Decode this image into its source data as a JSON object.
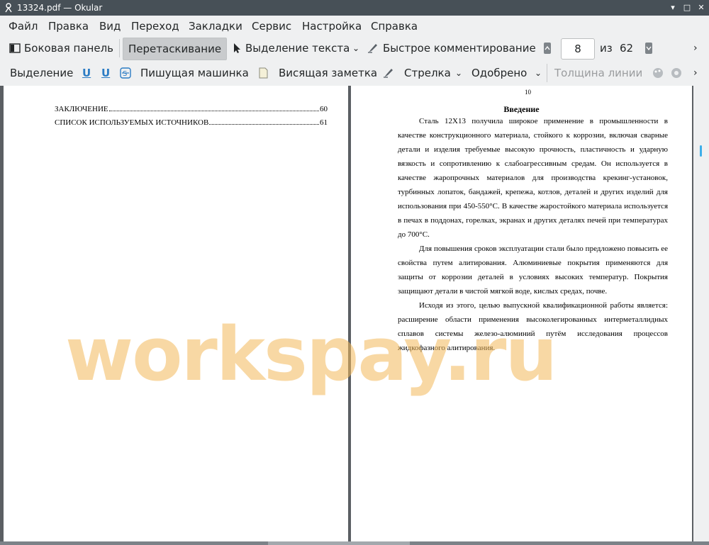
{
  "window": {
    "title": "13324.pdf — Okular"
  },
  "menu": [
    "Файл",
    "Правка",
    "Вид",
    "Переход",
    "Закладки",
    "Сервис",
    "Настройка",
    "Справка"
  ],
  "toolbar": {
    "sidebar": "Боковая панель",
    "browse": "Перетаскивание",
    "text_select": "Выделение текста",
    "quick_annotations": "Быстрое комментирование",
    "page_current": "8",
    "page_of": "из",
    "page_total": "62"
  },
  "annot_toolbar": {
    "highlight": "Выделение",
    "typewriter": "Пишущая машинка",
    "note": "Висящая заметка",
    "arrow": "Стрелка",
    "stamp": "Одобрено",
    "line_width": "Толщина линии"
  },
  "left_page": {
    "toc": [
      {
        "title": "ЗАКЛЮЧЕНИЕ",
        "page": "60"
      },
      {
        "title": "СПИСОК ИСПОЛЬЗУЕМЫХ ИСТОЧНИКОВ",
        "page": "61"
      }
    ]
  },
  "right_page": {
    "page_number": "10",
    "heading": "Введение",
    "paragraphs": [
      "Сталь 12Х13 получила широкое применение в промышленности в качестве конструкционного материала, стойкого к коррозии, включая сварные детали и изделия требуемые высокую прочность, пластичность и ударную вязкость и сопротивлению к слабоагрессивным средам. Он используется в качестве жаропрочных материалов для производства крекинг-установок, турбинных лопаток, бандажей, крепежа, котлов, деталей и других изделий для использования при 450-550°С. В качестве жаростойкого материала используется в печах в поддонах, горелках, экранах и других деталях печей при температурах до 700°С.",
      "Для повышения сроков эксплуатации стали было предложено повысить ее свойства путем алитирования. Алюминиевые покрытия применяются для защиты от коррозии деталей в условиях высоких температур. Покрытия защищают детали в чистой мягкой воде, кислых средах, почве.",
      "Исходя из этого, целью выпускной квалификационной работы является: расширение области применения высоколегированных интерметаллидных сплавов системы железо-алюминий путём исследования процессов жидкофазного алитирования."
    ]
  },
  "watermark": "workspay.ru",
  "colors": {
    "titlebar": "#475057",
    "accent": "#3daee9",
    "watermark": "#f3b95a"
  }
}
